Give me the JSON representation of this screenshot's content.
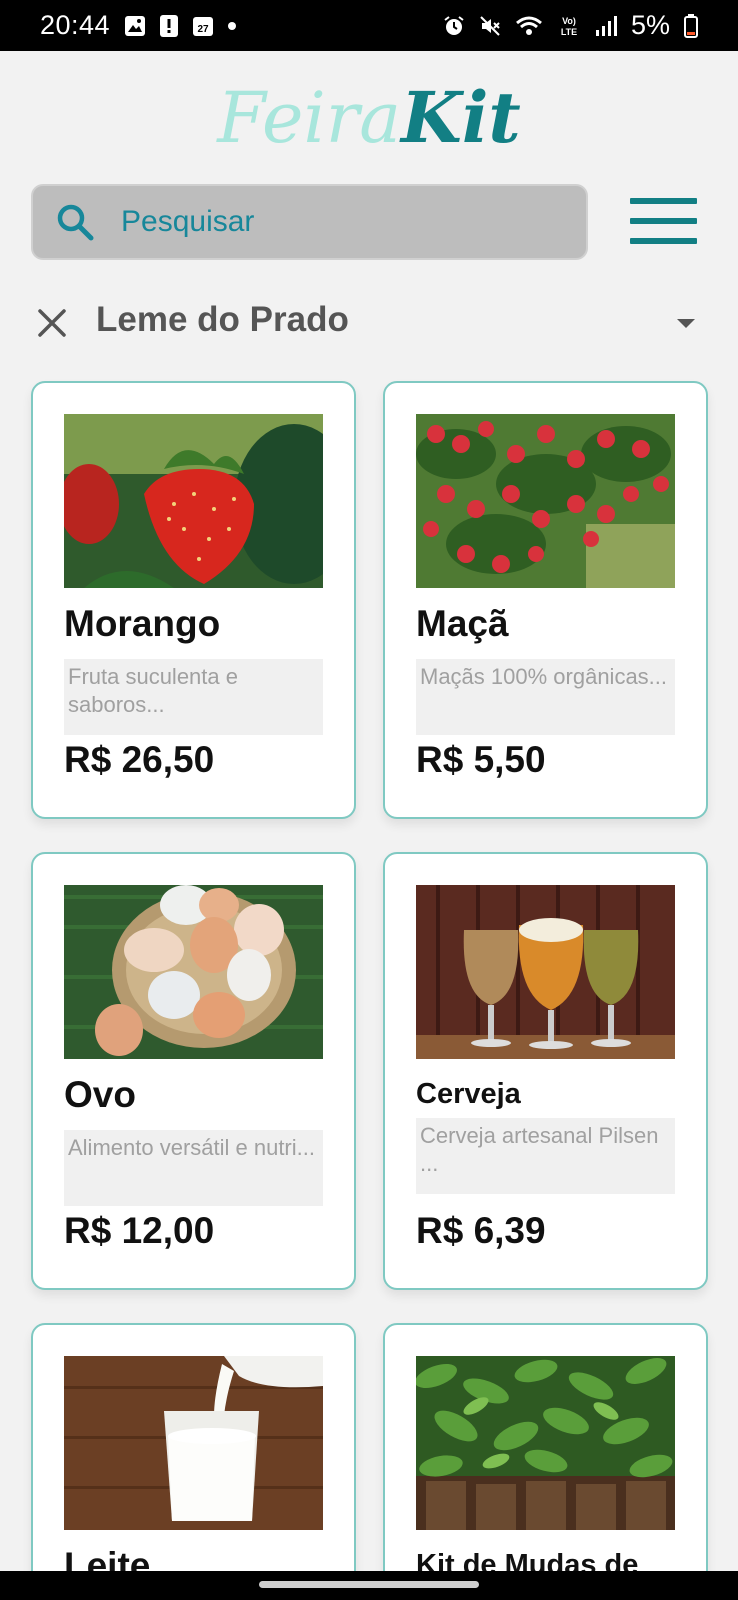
{
  "status_bar": {
    "time": "20:44",
    "battery": "5%",
    "icons_left": [
      "gallery-icon",
      "alert-icon",
      "calendar-icon",
      "dot-icon"
    ],
    "calendar_day": "27",
    "icons_right": [
      "alarm-icon",
      "mute-icon",
      "wifi-icon",
      "volte-icon",
      "signal-icon",
      "battery-icon"
    ],
    "volte_label": "Vo) LTE"
  },
  "logo": {
    "part1": "Feira",
    "part2": "Kit"
  },
  "search": {
    "placeholder": "Pesquisar"
  },
  "location_filter": {
    "value": "Leme do Prado"
  },
  "products": [
    {
      "name": "Morango",
      "description": "Fruta suculenta e saboros...",
      "price": "R$ 26,50",
      "image": "strawberry"
    },
    {
      "name": "Maçã",
      "description": "Maçãs 100% orgânicas...",
      "price": "R$ 5,50",
      "image": "apple-tree"
    },
    {
      "name": "Ovo",
      "description": "Alimento versátil e nutri...",
      "price": "R$ 12,00",
      "image": "eggs-basket"
    },
    {
      "name": "Cerveja",
      "description": "Cerveja artesanal Pilsen ...",
      "price": "R$ 6,39",
      "image": "beer-glasses"
    },
    {
      "name": "Leite",
      "image": "milk-glass"
    },
    {
      "name": "Kit de Mudas de",
      "image": "seedlings"
    }
  ],
  "colors": {
    "brand_dark": "#127f84",
    "brand_light": "#a8e6dc",
    "card_border": "#7fc9c2",
    "search_text": "#17879a"
  }
}
